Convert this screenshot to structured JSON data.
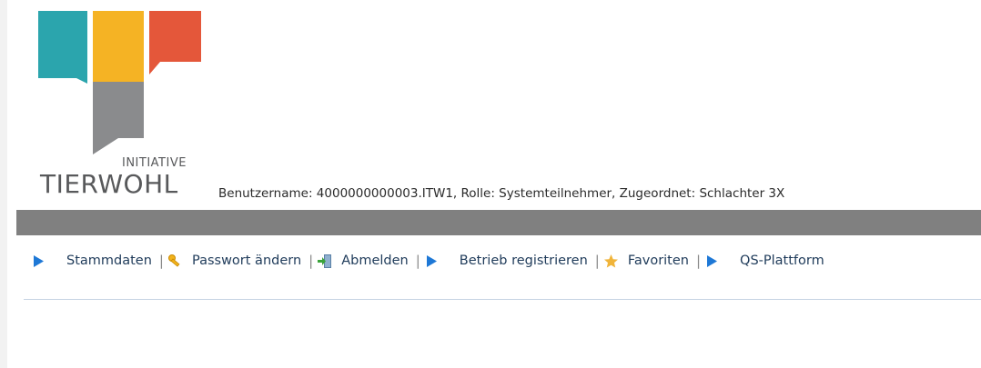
{
  "brand": {
    "logo_small": "INITIATIVE",
    "logo_big": "TIERWOHL",
    "colors": {
      "teal": "#2ba5ad",
      "yellow": "#f5b324",
      "red": "#e4573a",
      "gray": "#8a8b8d"
    }
  },
  "user_info": "Benutzername: 4000000000003.ITW1, Rolle: Systemteilnehmer, Zugeordnet: Schlachter 3X",
  "nav": {
    "items": [
      {
        "label": "Stammdaten",
        "icon": "arrow-icon"
      },
      {
        "label": "Passwort ändern",
        "icon": "key-icon"
      },
      {
        "label": "Abmelden",
        "icon": "logout-icon"
      },
      {
        "label": "Betrieb registrieren",
        "icon": "arrow-icon"
      },
      {
        "label": "Favoriten",
        "icon": "star-icon"
      },
      {
        "label": "QS-Plattform",
        "icon": "arrow-icon"
      }
    ],
    "separator": "|"
  }
}
